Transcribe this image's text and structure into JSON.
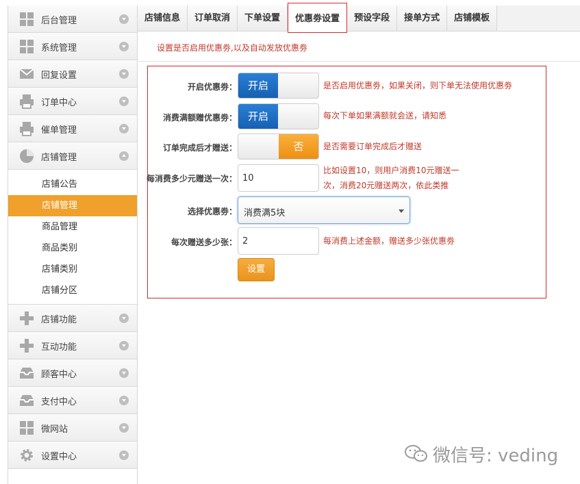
{
  "sidebar": {
    "items_top": [
      {
        "label": "后台管理",
        "icon": "grid-icon"
      },
      {
        "label": "系统管理",
        "icon": "grid-icon"
      },
      {
        "label": "回复设置",
        "icon": "mail-icon"
      },
      {
        "label": "订单中心",
        "icon": "printer-icon"
      },
      {
        "label": "催单管理",
        "icon": "printer-icon"
      },
      {
        "label": "店铺管理",
        "icon": "pie-chart-icon"
      }
    ],
    "submenu": [
      "店铺公告",
      "店铺管理",
      "商品管理",
      "商品类别",
      "店铺类别",
      "店铺分区"
    ],
    "active_sub": "店铺管理",
    "items_bottom": [
      {
        "label": "店铺功能",
        "icon": "plus-icon"
      },
      {
        "label": "互动功能",
        "icon": "plus-icon"
      },
      {
        "label": "顾客中心",
        "icon": "inbox-icon"
      },
      {
        "label": "支付中心",
        "icon": "inbox-icon"
      },
      {
        "label": "微网站",
        "icon": "grid-icon"
      },
      {
        "label": "设置中心",
        "icon": "gear-icon"
      }
    ]
  },
  "tabs": [
    "店铺信息",
    "订单取消",
    "下单设置",
    "优惠劵设置",
    "预设字段",
    "接单方式",
    "店铺模板"
  ],
  "active_tab": "优惠劵设置",
  "hint_top": "设置是否启用优惠劵,以及自动发放优惠劵",
  "form": {
    "enable_label": "开启优惠劵：",
    "enable_state": "开启",
    "enable_help": "是否启用优惠劵，如果关闭，则下单无法使用优惠劵",
    "full_label": "消费满额赠优惠劵：",
    "full_state": "开启",
    "full_help": "每次下单如果满额就会送，请知悉",
    "complete_label": "订单完成后才赠送：",
    "complete_state": "否",
    "complete_help": "是否需要订单完成后才赠送",
    "per_label": "每消费多少元赠送一次：",
    "per_value": "10",
    "per_help_1": "比如设置10，则用户消费10元赠送一",
    "per_help_2": "次，消费20元赠送两次，依此类推",
    "select_label": "选择优惠劵：",
    "select_value": "消费满5块",
    "count_label": "每次赠送多少张：",
    "count_value": "2",
    "count_help": "每消费上述金额，赠送多少张优惠劵",
    "submit_label": "设置"
  },
  "watermark": {
    "text": "微信号: veding",
    "icon": "wechat-icon"
  },
  "colors": {
    "accent": "#f0a02c",
    "toggle_on": "#1e6fc4",
    "help_text": "#c0392b",
    "highlight_border": "#d8262b"
  }
}
